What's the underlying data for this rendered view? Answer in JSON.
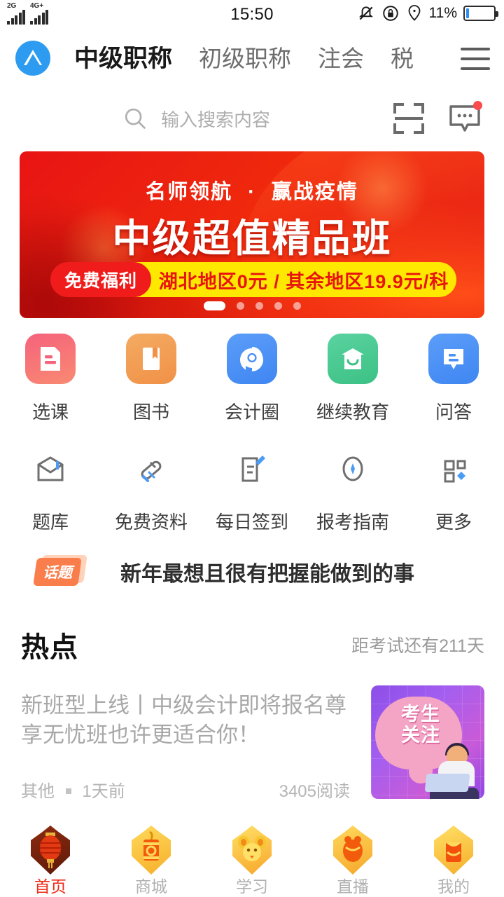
{
  "status_bar": {
    "network_labels": [
      "2G",
      "4G+"
    ],
    "time": "15:50",
    "battery_percent": "11%",
    "icons": [
      "signal-bars-icon",
      "mute-vibrate-icon",
      "screen-lock-rotation-icon",
      "location-pin-icon",
      "battery-icon"
    ]
  },
  "top_nav": {
    "logo_name": "app-logo",
    "tabs": [
      {
        "label": "中级职称",
        "active": true
      },
      {
        "label": "初级职称",
        "active": false
      },
      {
        "label": "注会",
        "active": false
      },
      {
        "label": "税",
        "active": false
      }
    ],
    "menu_label": "hamburger-menu"
  },
  "search": {
    "placeholder": "输入搜索内容",
    "icon": "search-icon",
    "scan_icon": "scan-qr-icon",
    "message_icon": "message-bubble-icon",
    "message_badge": true
  },
  "banner": {
    "subtitle_left": "名师领航",
    "subtitle_mid": "·",
    "subtitle_right": "赢战疫情",
    "title": "中级超值精品班",
    "tag": "免费福利",
    "price": "湖北地区0元 / 其余地区19.9元/科",
    "dot_count": 5,
    "active_dot": 0,
    "colors": {
      "bg_red": "#e81414",
      "pill_yellow": "#ffe800",
      "tag_red": "#f01b1b",
      "price_red": "#e8140f"
    }
  },
  "grid": {
    "row1": [
      {
        "label": "选课",
        "icon": "document-icon",
        "tile_color": "#f4667a"
      },
      {
        "label": "图书",
        "icon": "book-icon",
        "tile_color": "#f0a04f"
      },
      {
        "label": "会计圈",
        "icon": "circle-chat-icon",
        "tile_color": "#4a90f7"
      },
      {
        "label": "继续教育",
        "icon": "graduation-house-icon",
        "tile_color": "#46c88f"
      },
      {
        "label": "问答",
        "icon": "qa-bubble-icon",
        "tile_color": "#4a90f7"
      }
    ],
    "row2": [
      {
        "label": "题库",
        "icon": "question-bank-icon"
      },
      {
        "label": "免费资料",
        "icon": "free-material-pen-icon"
      },
      {
        "label": "每日签到",
        "icon": "daily-signin-icon"
      },
      {
        "label": "报考指南",
        "icon": "exam-guide-compass-icon"
      },
      {
        "label": "更多",
        "icon": "more-grid-icon"
      }
    ]
  },
  "topic": {
    "badge": "话题",
    "text": "新年最想且很有把握能做到的事"
  },
  "hot": {
    "title": "热点",
    "countdown": "距考试还有211天"
  },
  "article": {
    "title": "新班型上线丨中级会计即将报名尊享无忧班也许更适合你！",
    "category": "其他",
    "time": "1天前",
    "reads": "3405阅读",
    "thumb_line1": "考生",
    "thumb_line2": "关注"
  },
  "tabbar": [
    {
      "label": "首页",
      "icon": "lantern-home-icon",
      "active": true
    },
    {
      "label": "商城",
      "icon": "firecracker-shop-icon",
      "active": false
    },
    {
      "label": "学习",
      "icon": "mouse-study-icon",
      "active": false
    },
    {
      "label": "直播",
      "icon": "doll-live-icon",
      "active": false
    },
    {
      "label": "我的",
      "icon": "redpacket-mine-icon",
      "active": false
    }
  ]
}
